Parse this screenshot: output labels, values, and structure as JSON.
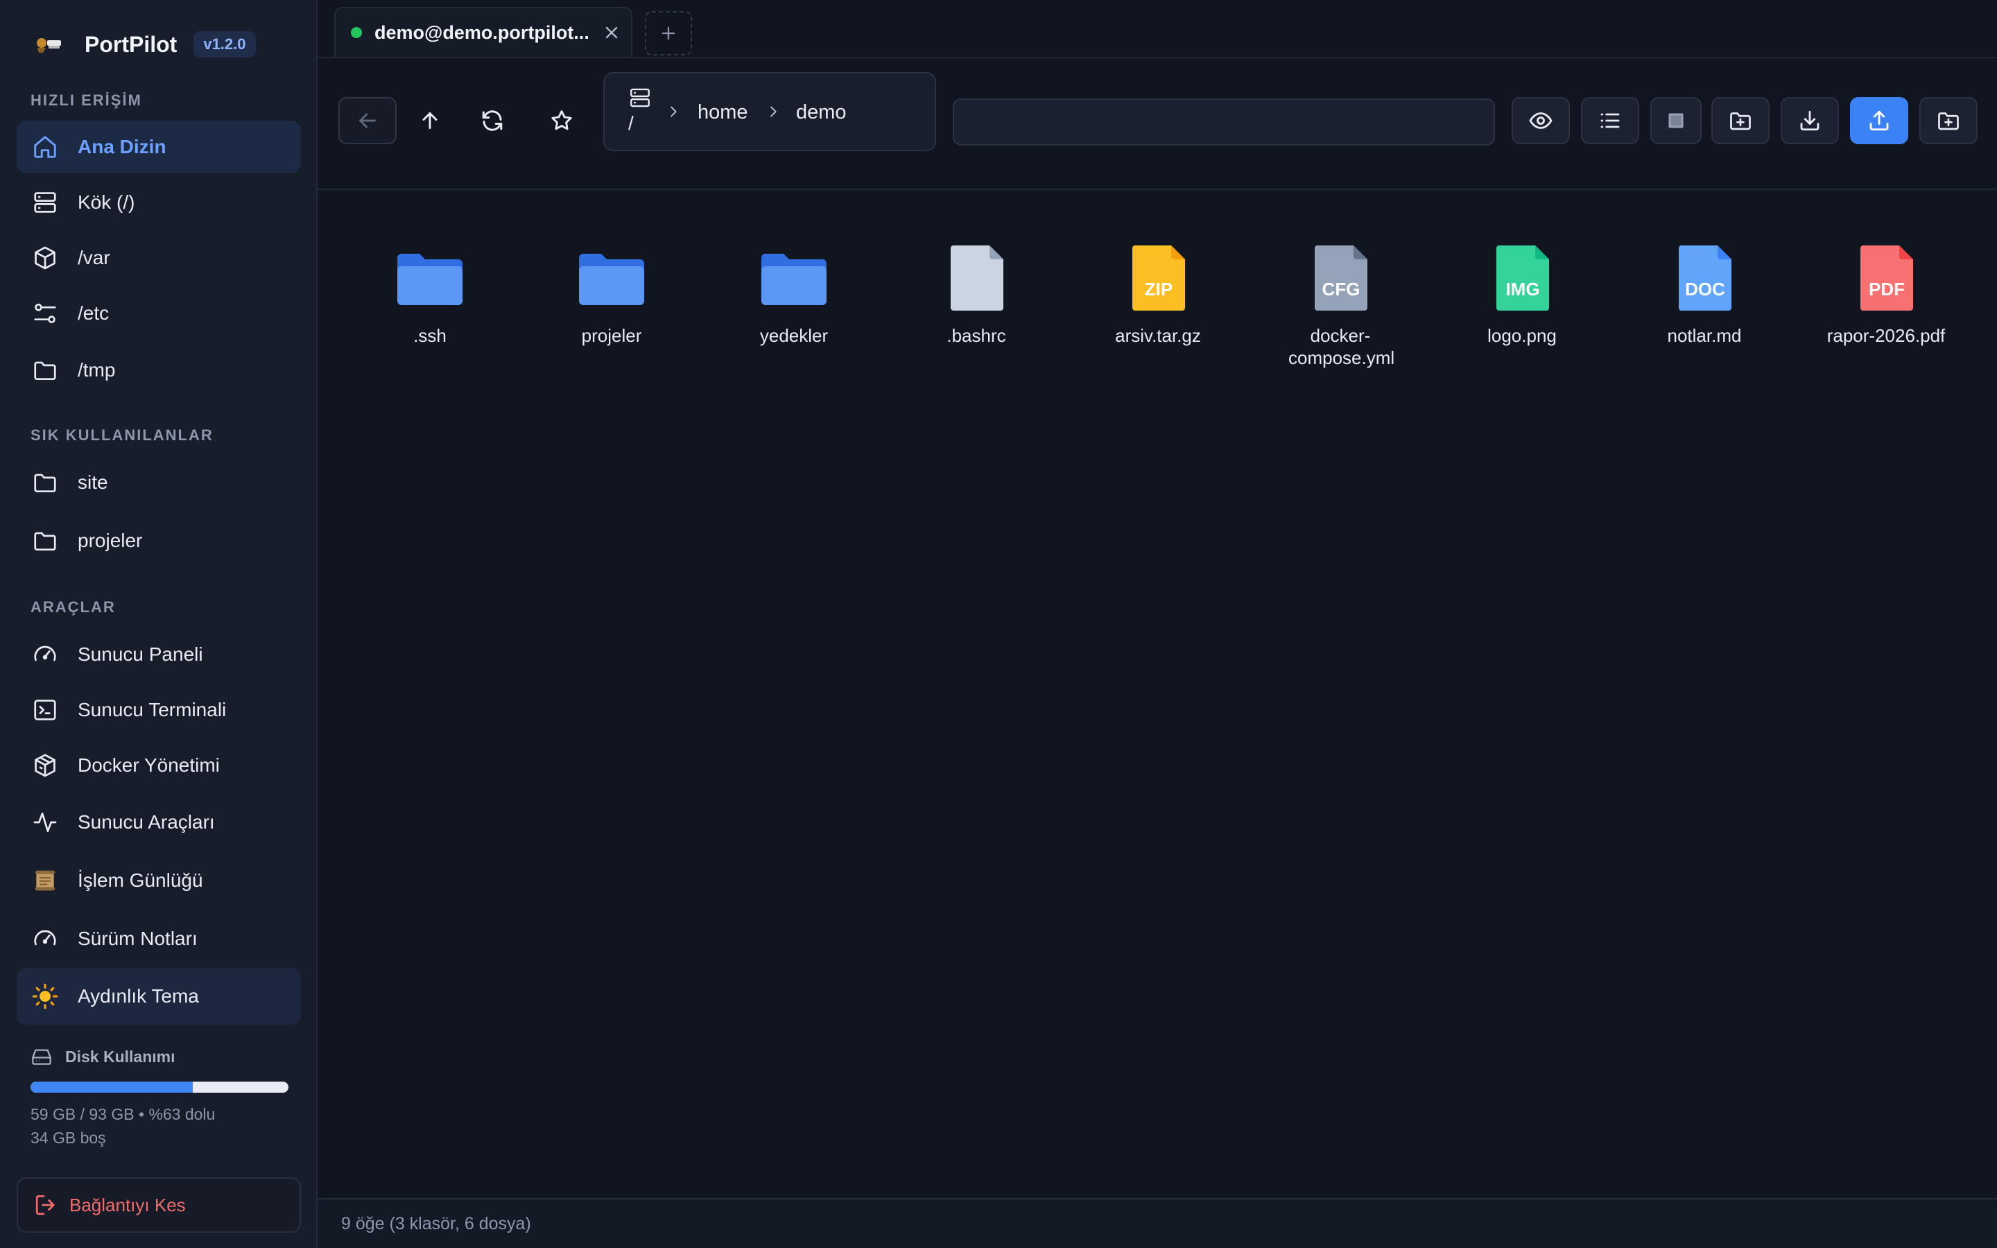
{
  "app": {
    "name": "PortPilot",
    "version": "v1.2.0"
  },
  "sidebar": {
    "quick_access_title": "HIZLI ERİŞİM",
    "quick_access": [
      {
        "label": "Ana Dizin",
        "icon": "home-icon"
      },
      {
        "label": "Kök (/)",
        "icon": "server-icon"
      },
      {
        "label": "/var",
        "icon": "box-icon"
      },
      {
        "label": "/etc",
        "icon": "sliders-icon"
      },
      {
        "label": "/tmp",
        "icon": "folder-icon"
      }
    ],
    "favorites_title": "SIK KULLANILANLAR",
    "favorites": [
      {
        "label": "site",
        "icon": "folder-icon"
      },
      {
        "label": "projeler",
        "icon": "folder-icon"
      }
    ],
    "tools_title": "ARAÇLAR",
    "tools": [
      {
        "label": "Sunucu Paneli",
        "icon": "gauge-icon"
      },
      {
        "label": "Sunucu Terminali",
        "icon": "terminal-icon"
      },
      {
        "label": "Docker Yönetimi",
        "icon": "docker-box-icon"
      },
      {
        "label": "Sunucu Araçları",
        "icon": "activity-icon"
      },
      {
        "label": "İşlem Günlüğü",
        "icon": "scroll-icon"
      },
      {
        "label": "Sürüm Notları",
        "icon": "gauge-icon"
      }
    ],
    "theme_toggle": {
      "label": "Aydınlık Tema",
      "icon": "sun-icon"
    },
    "disk": {
      "title": "Disk Kullanımı",
      "used_fraction": 0.63,
      "line1": "59 GB / 93 GB • %63 dolu",
      "line2": "34 GB boş"
    },
    "disconnect_label": "Bağlantıyı Kes"
  },
  "tabs": [
    {
      "title": "demo@demo.portpilot...",
      "status_color": "#22c55e"
    }
  ],
  "toolbar": {
    "breadcrumb": [
      {
        "label": "/"
      },
      {
        "label": "home"
      },
      {
        "label": "demo"
      }
    ],
    "search": {
      "value": "",
      "placeholder": ""
    }
  },
  "files": [
    {
      "name": ".ssh",
      "type": "folder"
    },
    {
      "name": "projeler",
      "type": "folder"
    },
    {
      "name": "yedekler",
      "type": "folder"
    },
    {
      "name": ".bashrc",
      "type": "file",
      "badge": "",
      "color": "#cbd5e1"
    },
    {
      "name": "arsiv.tar.gz",
      "type": "file",
      "badge": "ZIP",
      "color": "#fbbf24"
    },
    {
      "name": "docker-compose.yml",
      "type": "file",
      "badge": "CFG",
      "color": "#94a3b8"
    },
    {
      "name": "logo.png",
      "type": "file",
      "badge": "IMG",
      "color": "#34d399"
    },
    {
      "name": "notlar.md",
      "type": "file",
      "badge": "DOC",
      "color": "#60a5fa"
    },
    {
      "name": "rapor-2026.pdf",
      "type": "file",
      "badge": "PDF",
      "color": "#f87171"
    }
  ],
  "status": {
    "summary": "9 öğe (3 klasör, 6 dosya)"
  }
}
